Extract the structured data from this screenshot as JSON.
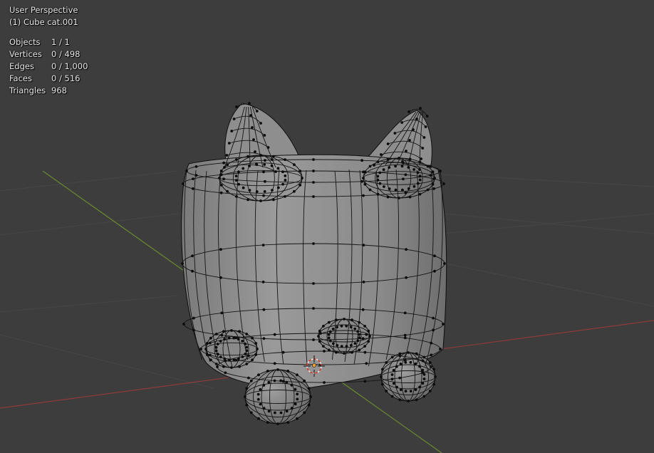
{
  "viewport": {
    "view_name": "User Perspective",
    "object_name": "(1) Cube cat.001",
    "stats": [
      {
        "label": "Objects",
        "value": "1 / 1"
      },
      {
        "label": "Vertices",
        "value": "0 / 498"
      },
      {
        "label": "Edges",
        "value": "0 / 1,000"
      },
      {
        "label": "Faces",
        "value": "0 / 516"
      },
      {
        "label": "Triangles",
        "value": "968"
      }
    ]
  },
  "colors": {
    "background": "#3d3d3d",
    "grid": "#464646",
    "x_axis": "#8f3a3a",
    "y_axis": "#6b8a2f",
    "mesh_fill": "#8c8c8c",
    "wire": "#101010",
    "cursor": "#e05a3a"
  },
  "icons": {
    "cursor": "3d-cursor-icon",
    "origin": "origin-dot-icon"
  }
}
